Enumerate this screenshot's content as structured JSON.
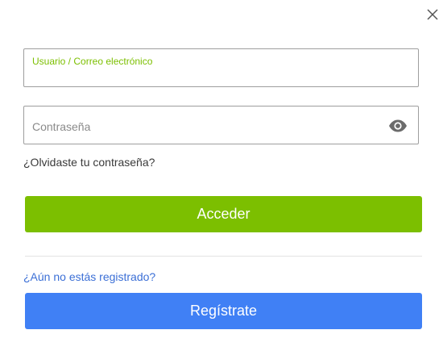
{
  "dialog": {
    "close_icon": "close-icon"
  },
  "form": {
    "username": {
      "label": "Usuario / Correo electrónico",
      "value": ""
    },
    "password": {
      "placeholder": "Contraseña",
      "toggle_icon": "eye-icon"
    },
    "forgot_password_label": "¿Olvidaste tu contraseña?",
    "login_button_label": "Acceder",
    "register_prompt": "¿Aún no estás registrado?",
    "register_button_label": "Regístrate"
  },
  "colors": {
    "accent_green": "#7cbf00",
    "accent_blue": "#4080f5",
    "link_blue": "#3b6fd6",
    "border": "#9e9e9e"
  }
}
